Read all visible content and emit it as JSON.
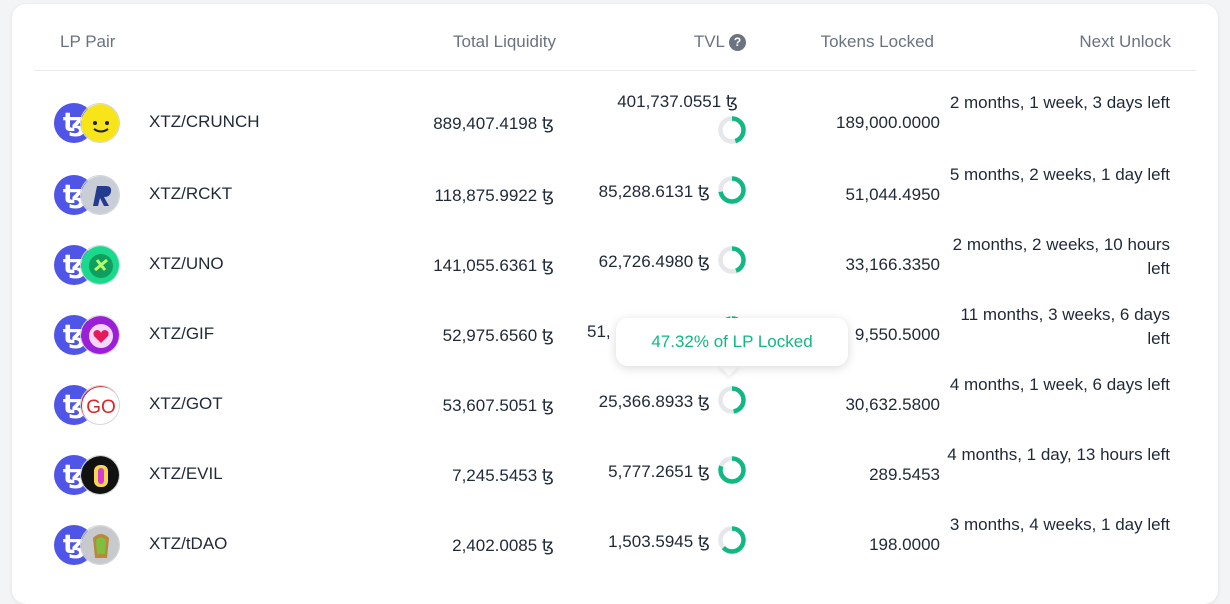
{
  "table": {
    "headers": {
      "lp_pair": "LP Pair",
      "total_liquidity": "Total Liquidity",
      "tvl": "TVL",
      "tvl_help": "?",
      "tokens_locked": "Tokens Locked",
      "next_unlock": "Next Unlock"
    },
    "rows": [
      {
        "pair": "XTZ/CRUNCH",
        "tez_icon": "ꜩ",
        "total_liquidity": "889,407.4198 ꜩ",
        "tvl": "401,737.0551 ꜩ",
        "lp_locked_fraction": 0.45,
        "tokens_locked": "189,000.0000",
        "next_unlock": "2 months, 1 week, 3 days left"
      },
      {
        "pair": "XTZ/RCKT",
        "tez_icon": "ꜩ",
        "total_liquidity": "118,875.9922 ꜩ",
        "tvl": "85,288.6131 ꜩ",
        "lp_locked_fraction": 0.72,
        "tokens_locked": "51,044.4950",
        "next_unlock": "5 months, 2 weeks, 1 day left"
      },
      {
        "pair": "XTZ/UNO",
        "tez_icon": "ꜩ",
        "total_liquidity": "141,055.6361 ꜩ",
        "tvl": "62,726.4980 ꜩ",
        "lp_locked_fraction": 0.44,
        "tokens_locked": "33,166.3350",
        "next_unlock": "2 months, 2 weeks, 10 hours left"
      },
      {
        "pair": "XTZ/GIF",
        "tez_icon": "ꜩ",
        "total_liquidity": "52,975.6560 ꜩ",
        "tvl": "51,",
        "lp_locked_fraction": 0.97,
        "tokens_locked": "9,550.5000",
        "next_unlock": "11 months, 3 weeks, 6 days left"
      },
      {
        "pair": "XTZ/GOT",
        "tez_icon": "ꜩ",
        "total_liquidity": "53,607.5051 ꜩ",
        "tvl": "25,366.8933 ꜩ",
        "lp_locked_fraction": 0.4732,
        "tokens_locked": "30,632.5800",
        "next_unlock": "4 months, 1 week, 6 days left"
      },
      {
        "pair": "XTZ/EVIL",
        "tez_icon": "ꜩ",
        "total_liquidity": "7,245.5453 ꜩ",
        "tvl": "5,777.2651 ꜩ",
        "lp_locked_fraction": 0.8,
        "tokens_locked": "289.5453",
        "next_unlock": "4 months, 1 day, 13 hours left"
      },
      {
        "pair": "XTZ/tDAO",
        "tez_icon": "ꜩ",
        "total_liquidity": "2,402.0085 ꜩ",
        "tvl": "1,503.5945 ꜩ",
        "lp_locked_fraction": 0.63,
        "tokens_locked": "198.0000",
        "next_unlock": "3 months, 4 weeks, 1 day left"
      }
    ]
  },
  "tooltip": {
    "text": "47.32% of LP Locked"
  },
  "colors": {
    "accent_green": "#10b981",
    "tez_blue": "#4f55e6",
    "donut_track": "#e5e7eb"
  }
}
